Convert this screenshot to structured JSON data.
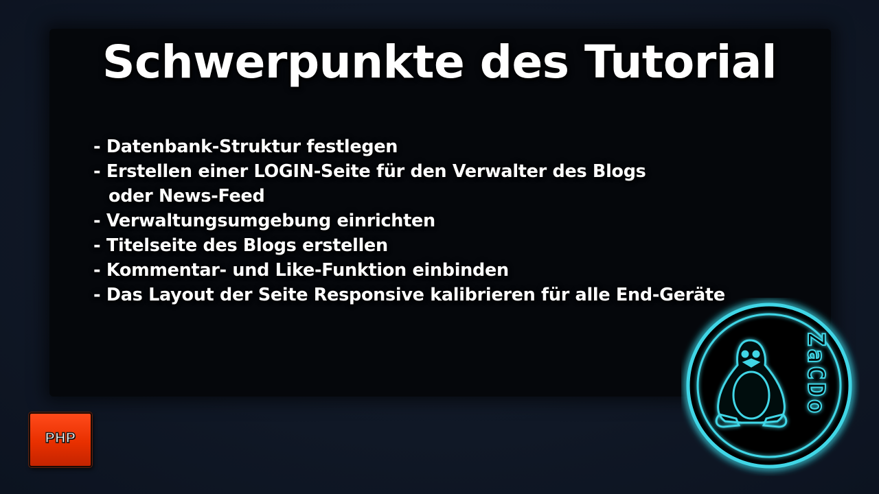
{
  "slide": {
    "title": "Schwerpunkte des Tutorial",
    "bullets": [
      "- Datenbank-Struktur festlegen",
      "- Erstellen einer LOGIN-Seite für den Verwalter des Blogs",
      "oder News-Feed",
      "- Verwaltungsumgebung einrichten",
      "- Titelseite des Blogs erstellen",
      "- Kommentar- und Like-Funktion einbinden",
      "- Das Layout der Seite Responsive kalibrieren für alle End-Geräte"
    ]
  },
  "badge": {
    "label": "PHP",
    "color": "#e83000"
  },
  "logo": {
    "text": "ZaCDo",
    "icon": "tux-penguin-icon",
    "glow_color": "#3fd6e6"
  },
  "colors": {
    "background": "#101826",
    "panel": "#05070b",
    "text": "#ffffff"
  }
}
